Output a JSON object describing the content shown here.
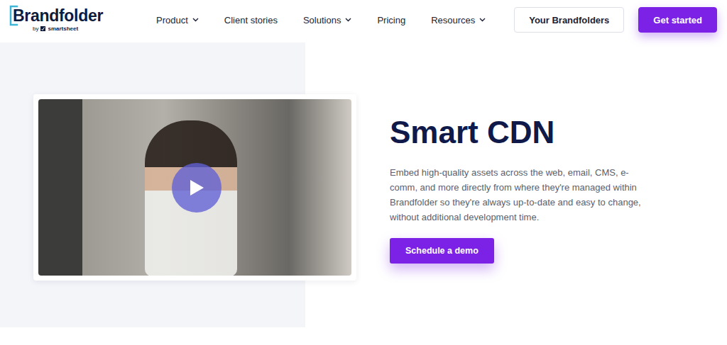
{
  "logo": {
    "name": "Brandfolder",
    "byline": "by",
    "parent": "smartsheet"
  },
  "nav": [
    {
      "label": "Product",
      "has_menu": true
    },
    {
      "label": "Client stories",
      "has_menu": false
    },
    {
      "label": "Solutions",
      "has_menu": true
    },
    {
      "label": "Pricing",
      "has_menu": false
    },
    {
      "label": "Resources",
      "has_menu": true
    }
  ],
  "header_buttons": [
    {
      "label": "Your Brandfolders",
      "kind": "outline"
    },
    {
      "label": "Get started",
      "kind": "solid"
    }
  ],
  "hero": {
    "title": "Smart CDN",
    "body": "Embed high-quality assets across the web, email, CMS, e-comm, and more directly from where they're managed within Brandfolder so they're always up-to-date and easy to change, without additional development time.",
    "button": "Schedule a demo"
  }
}
